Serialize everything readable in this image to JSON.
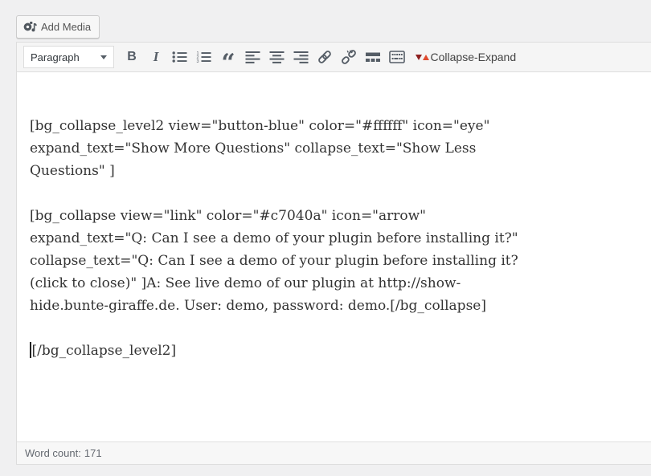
{
  "media_bar": {
    "add_media_label": "Add Media"
  },
  "toolbar": {
    "format_select_value": "Paragraph",
    "bold_glyph": "B",
    "italic_glyph": "I",
    "blockquote_glyph": "“",
    "button_icons": [
      "bold",
      "italic",
      "bulleted-list",
      "numbered-list",
      "blockquote",
      "align-left",
      "align-center",
      "align-right",
      "insert-link",
      "remove-link",
      "read-more",
      "toolbar-toggle"
    ],
    "collapse_expand_label": "Collapse-Expand",
    "collapse_expand_icon_colors": {
      "down_triangle": "#8d1f1f",
      "up_triangle": "#df4a2f"
    }
  },
  "editor": {
    "paragraphs": [
      {
        "lines": [
          "[bg_collapse_level2 view=\"button-blue\" color=\"#ffffff\" icon=\"eye\"",
          "expand_text=\"Show More Questions\" collapse_text=\"Show Less",
          "Questions\" ]"
        ]
      },
      {
        "lines": [
          "[bg_collapse view=\"link\" color=\"#c7040a\" icon=\"arrow\"",
          "expand_text=\"Q: Can I see a demo of your plugin before installing it?\"",
          "collapse_text=\"Q: Can I see a demo of your plugin before installing it?",
          "(click to close)\" ]A: See live demo of our plugin at http://show-",
          "hide.bunte-giraffe.de. User: demo, password: demo.[/bg_collapse]"
        ]
      },
      {
        "lines": [
          "[/bg_collapse_level2]"
        ]
      }
    ]
  },
  "statusbar": {
    "word_count_label": "Word count:",
    "word_count_value": "171"
  },
  "colors": {
    "page_bg": "#f0f0f1",
    "toolbar_bg": "#f5f5f5",
    "panel_border": "#dddddd",
    "content_text": "#333333",
    "icon": "#555d66",
    "statusbar_bg": "#f7f7f7"
  }
}
